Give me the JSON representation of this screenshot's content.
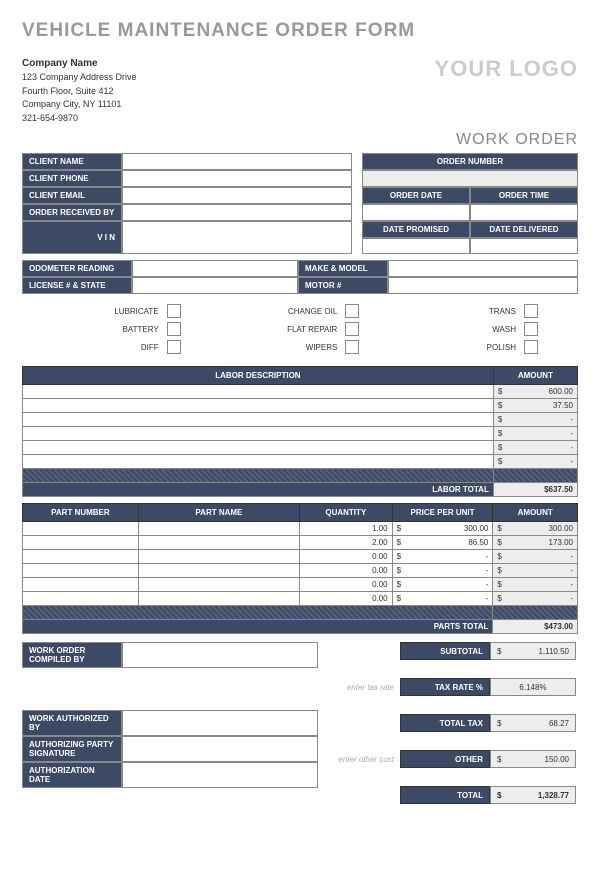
{
  "title": "VEHICLE MAINTENANCE ORDER FORM",
  "logo_text": "YOUR LOGO",
  "work_order_label": "WORK ORDER",
  "company": {
    "name": "Company Name",
    "addr1": "123 Company Address Drive",
    "addr2": "Fourth Floor, Suite 412",
    "city": "Company City, NY 11101",
    "phone": "321-654-9870"
  },
  "client_headers": {
    "name": "CLIENT NAME",
    "phone": "CLIENT PHONE",
    "email": "CLIENT EMAIL",
    "received": "ORDER RECEIVED BY",
    "vin": "V I N",
    "order_num": "ORDER NUMBER",
    "order_date": "ORDER DATE",
    "order_time": "ORDER TIME",
    "date_promised": "DATE PROMISED",
    "date_delivered": "DATE DELIVERED"
  },
  "vehicle_headers": {
    "odometer": "ODOMETER READING",
    "license": "LICENSE # & STATE",
    "make": "MAKE & MODEL",
    "motor": "MOTOR #"
  },
  "service_checks": [
    "LUBRICATE",
    "CHANGE OIL",
    "TRANS",
    "BATTERY",
    "FLAT REPAIR",
    "WASH",
    "DIFF",
    "WIPERS",
    "POLISH"
  ],
  "labor": {
    "header_desc": "LABOR DESCRIPTION",
    "header_amt": "AMOUNT",
    "total_label": "LABOR TOTAL",
    "total": "637.50",
    "rows": [
      {
        "desc": "",
        "amount": "600.00"
      },
      {
        "desc": "",
        "amount": "37.50"
      },
      {
        "desc": "",
        "amount": "-"
      },
      {
        "desc": "",
        "amount": "-"
      },
      {
        "desc": "",
        "amount": "-"
      },
      {
        "desc": "",
        "amount": "-"
      }
    ]
  },
  "parts": {
    "headers": {
      "num": "PART NUMBER",
      "name": "PART NAME",
      "qty": "QUANTITY",
      "price": "PRICE PER UNIT",
      "amount": "AMOUNT"
    },
    "total_label": "PARTS TOTAL",
    "total": "473.00",
    "rows": [
      {
        "num": "",
        "name": "",
        "qty": "1.00",
        "price": "300.00",
        "amount": "300.00"
      },
      {
        "num": "",
        "name": "",
        "qty": "2.00",
        "price": "86.50",
        "amount": "173.00"
      },
      {
        "num": "",
        "name": "",
        "qty": "0.00",
        "price": "-",
        "amount": "-"
      },
      {
        "num": "",
        "name": "",
        "qty": "0.00",
        "price": "-",
        "amount": "-"
      },
      {
        "num": "",
        "name": "",
        "qty": "0.00",
        "price": "-",
        "amount": "-"
      },
      {
        "num": "",
        "name": "",
        "qty": "0.00",
        "price": "-",
        "amount": "-"
      }
    ]
  },
  "compiled_label": "WORK ORDER COMPILED BY",
  "auth": {
    "by": "WORK AUTHORIZED BY",
    "sig": "AUTHORIZING PARTY SIGNATURE",
    "date": "AUTHORIZATION DATE"
  },
  "totals": {
    "subtotal_label": "SUBTOTAL",
    "subtotal": "1,110.50",
    "tax_rate_label": "TAX RATE %",
    "tax_rate_hint": "enter tax rate",
    "tax_rate": "6.148%",
    "total_tax_label": "TOTAL TAX",
    "total_tax": "68.27",
    "other_label": "OTHER",
    "other_hint": "enter other cost",
    "other": "150.00",
    "total_label": "TOTAL",
    "total": "1,328.77"
  },
  "currency": "$"
}
